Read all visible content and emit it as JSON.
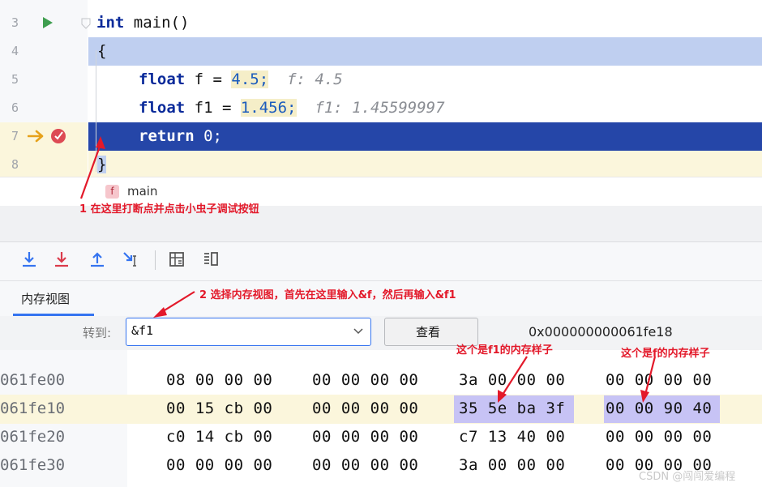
{
  "editor": {
    "lines": [
      {
        "num": "3",
        "code": "int main()"
      },
      {
        "num": "4",
        "code": "{"
      },
      {
        "num": "5",
        "kw": "float",
        "var": " f = ",
        "val": "4.5",
        "end": ";",
        "hint": "f: 4.5"
      },
      {
        "num": "6",
        "kw": "float",
        "var": " f1 = ",
        "val": "1.456",
        "end": ";",
        "hint": "f1: 1.45599997"
      },
      {
        "num": "7",
        "kw": "return",
        "rest": " 0;"
      },
      {
        "num": "8",
        "code": "}"
      }
    ],
    "breadcrumb": {
      "icon_letter": "f",
      "label": "main"
    }
  },
  "annotations": {
    "a1": "1 在这里打断点并点击小虫子调试按钮",
    "a2": "2 选择内存视图，首先在这里输入&f，然后再输入&f1",
    "a3": "这个是f1的内存样子",
    "a4": "这个是f的内存样子"
  },
  "memory": {
    "tab_label": "内存视图",
    "goto_label": "转到:",
    "goto_value": "&f1",
    "view_button": "查看",
    "address_display": "0x000000000061fe18",
    "rows": [
      {
        "addr": "061fe00",
        "g1": "08 00 00 00",
        "g2": "00 00 00 00",
        "g3": "3a 00 00 00",
        "g4": "00 00 00 00"
      },
      {
        "addr": "061fe10",
        "g1": "00 15 cb 00",
        "g2": "00 00 00 00",
        "g3": "35 5e ba 3f",
        "g4": "00 00 90 40"
      },
      {
        "addr": "061fe20",
        "g1": "c0 14 cb 00",
        "g2": "00 00 00 00",
        "g3": "c7 13 40 00",
        "g4": "00 00 00 00"
      },
      {
        "addr": "061fe30",
        "g1": "00 00 00 00",
        "g2": "00 00 00 00",
        "g3": "3a 00 00 00",
        "g4": "00 00 00 00"
      }
    ]
  },
  "watermark": "CSDN @闯闯爱编程",
  "colors": {
    "accent_blue": "#2546a8",
    "current_line": "#bfcff0",
    "highlight_bytes": "#c7c3f5",
    "annotation_red": "#e3192a",
    "toolbar_blue": "#3574f0",
    "toolbar_red": "#db3b4b"
  }
}
